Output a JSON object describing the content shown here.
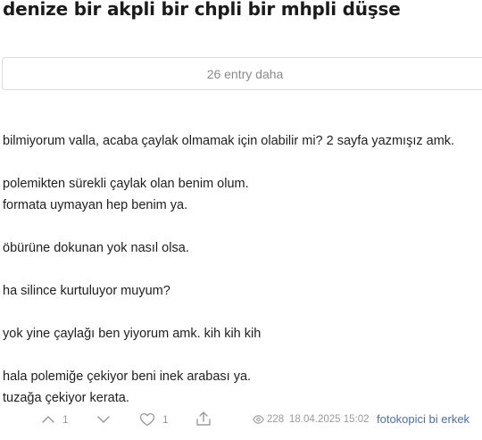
{
  "topic": {
    "title": "denize bir akpli bir chpli bir mhpli düşse"
  },
  "more_entries_label": "26 entry daha",
  "entry": {
    "paragraphs": [
      [
        "bilmiyorum valla, acaba çaylak olmamak için olabilir mi? 2 sayfa yazmışız amk."
      ],
      [
        "polemikten sürekli çaylak olan benim olum.",
        "formata uymayan hep benim ya."
      ],
      [
        "öbürüne dokunan yok nasıl olsa."
      ],
      [
        "ha silince kurtuluyor muyum?"
      ],
      [
        "yok yine çaylağı ben yiyorum amk. kih kih kih"
      ],
      [
        "hala polemiğe çekiyor beni inek arabası ya.",
        "tuzağa çekiyor kerata."
      ]
    ]
  },
  "footer": {
    "upvotes": "1",
    "favorites": "1",
    "views": "228",
    "date": "18.04.2025 15:02",
    "author": "fotokopici bi erkek",
    "icons": [
      "chevron-up-icon",
      "chevron-down-icon",
      "heart-icon",
      "share-icon",
      "eye-icon"
    ]
  },
  "colors": {
    "author_link": "#4d6fa3",
    "muted": "#9a9a9a",
    "border": "#dcdcdc"
  }
}
